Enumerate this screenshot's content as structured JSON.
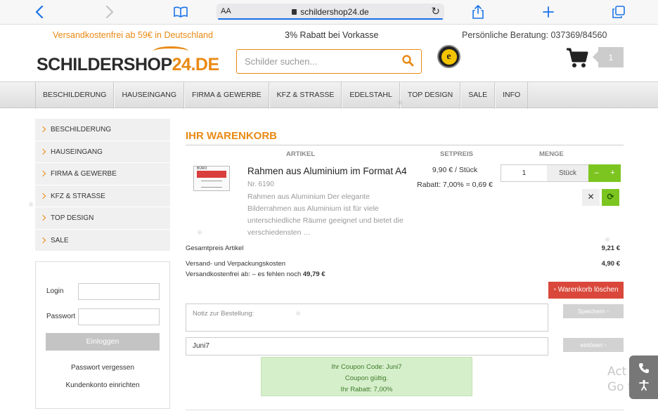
{
  "browser": {
    "aa_label": "AA",
    "url": "schildershop24.de"
  },
  "topbar": {
    "shipping": "Versandkostenfrei ab 59€ in Deutschland",
    "discount": "3% Rabatt bei Vorkasse",
    "consult": "Persönliche Beratung: 037369/84560"
  },
  "logo": {
    "text_main": "SCHILDERSHOP",
    "text_num": "24",
    "text_de": ".DE"
  },
  "search": {
    "placeholder": "Schilder suchen..."
  },
  "badge": {
    "letter": "e"
  },
  "cart": {
    "count": "1"
  },
  "nav": {
    "items": [
      "BESCHILDERUNG",
      "HAUSEINGANG",
      "FIRMA & GEWERBE",
      "KFZ & STRASSE",
      "EDELSTAHL",
      "TOP DESIGN",
      "SALE",
      "INFO"
    ]
  },
  "sidebar": {
    "categories": [
      "BESCHILDERUNG",
      "HAUSEINGANG",
      "FIRMA & GEWERBE",
      "KFZ & STRASSE",
      "TOP DESIGN",
      "SALE"
    ]
  },
  "login": {
    "login_label": "Login",
    "password_label": "Passwort",
    "submit": "Einloggen",
    "forgot": "Passwort vergessen",
    "register": "Kundenkonto einrichten"
  },
  "basket": {
    "title": "IHR WARENKORB",
    "col_article": "ARTIKEL",
    "col_price": "SETPREIS",
    "col_qty": "MENGE",
    "product": {
      "image_label": "BÜRO",
      "name": "Rahmen aus Aluminium im Format A4",
      "nr": "Nr. 6190",
      "description": "Rahmen aus Aluminium Der elegante Bilderrahmen aus Aluminium ist für viele unterschiedliche Räume geeignet und bietet die verschiedensten …",
      "price": "9,90 € / Stück",
      "discount": "Rabatt: 7,00% = 0,69 €",
      "qty": "1",
      "unit": "Stück",
      "minus": "–",
      "plus": "+",
      "remove": "✕",
      "refresh": "⟳"
    },
    "total_label": "Gesamtpreis Artikel",
    "total_value": "9,21 €",
    "shipping_label": "Versand- und Verpackungskosten",
    "shipping_value": "4,90 €",
    "free_shipping_prefix": "Versandkostenfrei ab: – es fehlen noch ",
    "free_shipping_amount": "49,79 €",
    "clear_button": "Warenkorb löschen",
    "note_placeholder": "Notiz zur Bestellung:",
    "save_button": "Speichern",
    "coupon_value": "Juni7",
    "redeem_button": "einlösen",
    "coupon_line1": "Ihr Coupon Code: Juni7",
    "coupon_line2": "Coupon gültig.",
    "coupon_line3": "Ihr Rabatt: 7,00%"
  },
  "os_overlay": {
    "line1": "Act",
    "line2": "Go t"
  },
  "colors": {
    "accent": "#e98a15",
    "green": "#7cc520",
    "danger": "#d9483a"
  }
}
